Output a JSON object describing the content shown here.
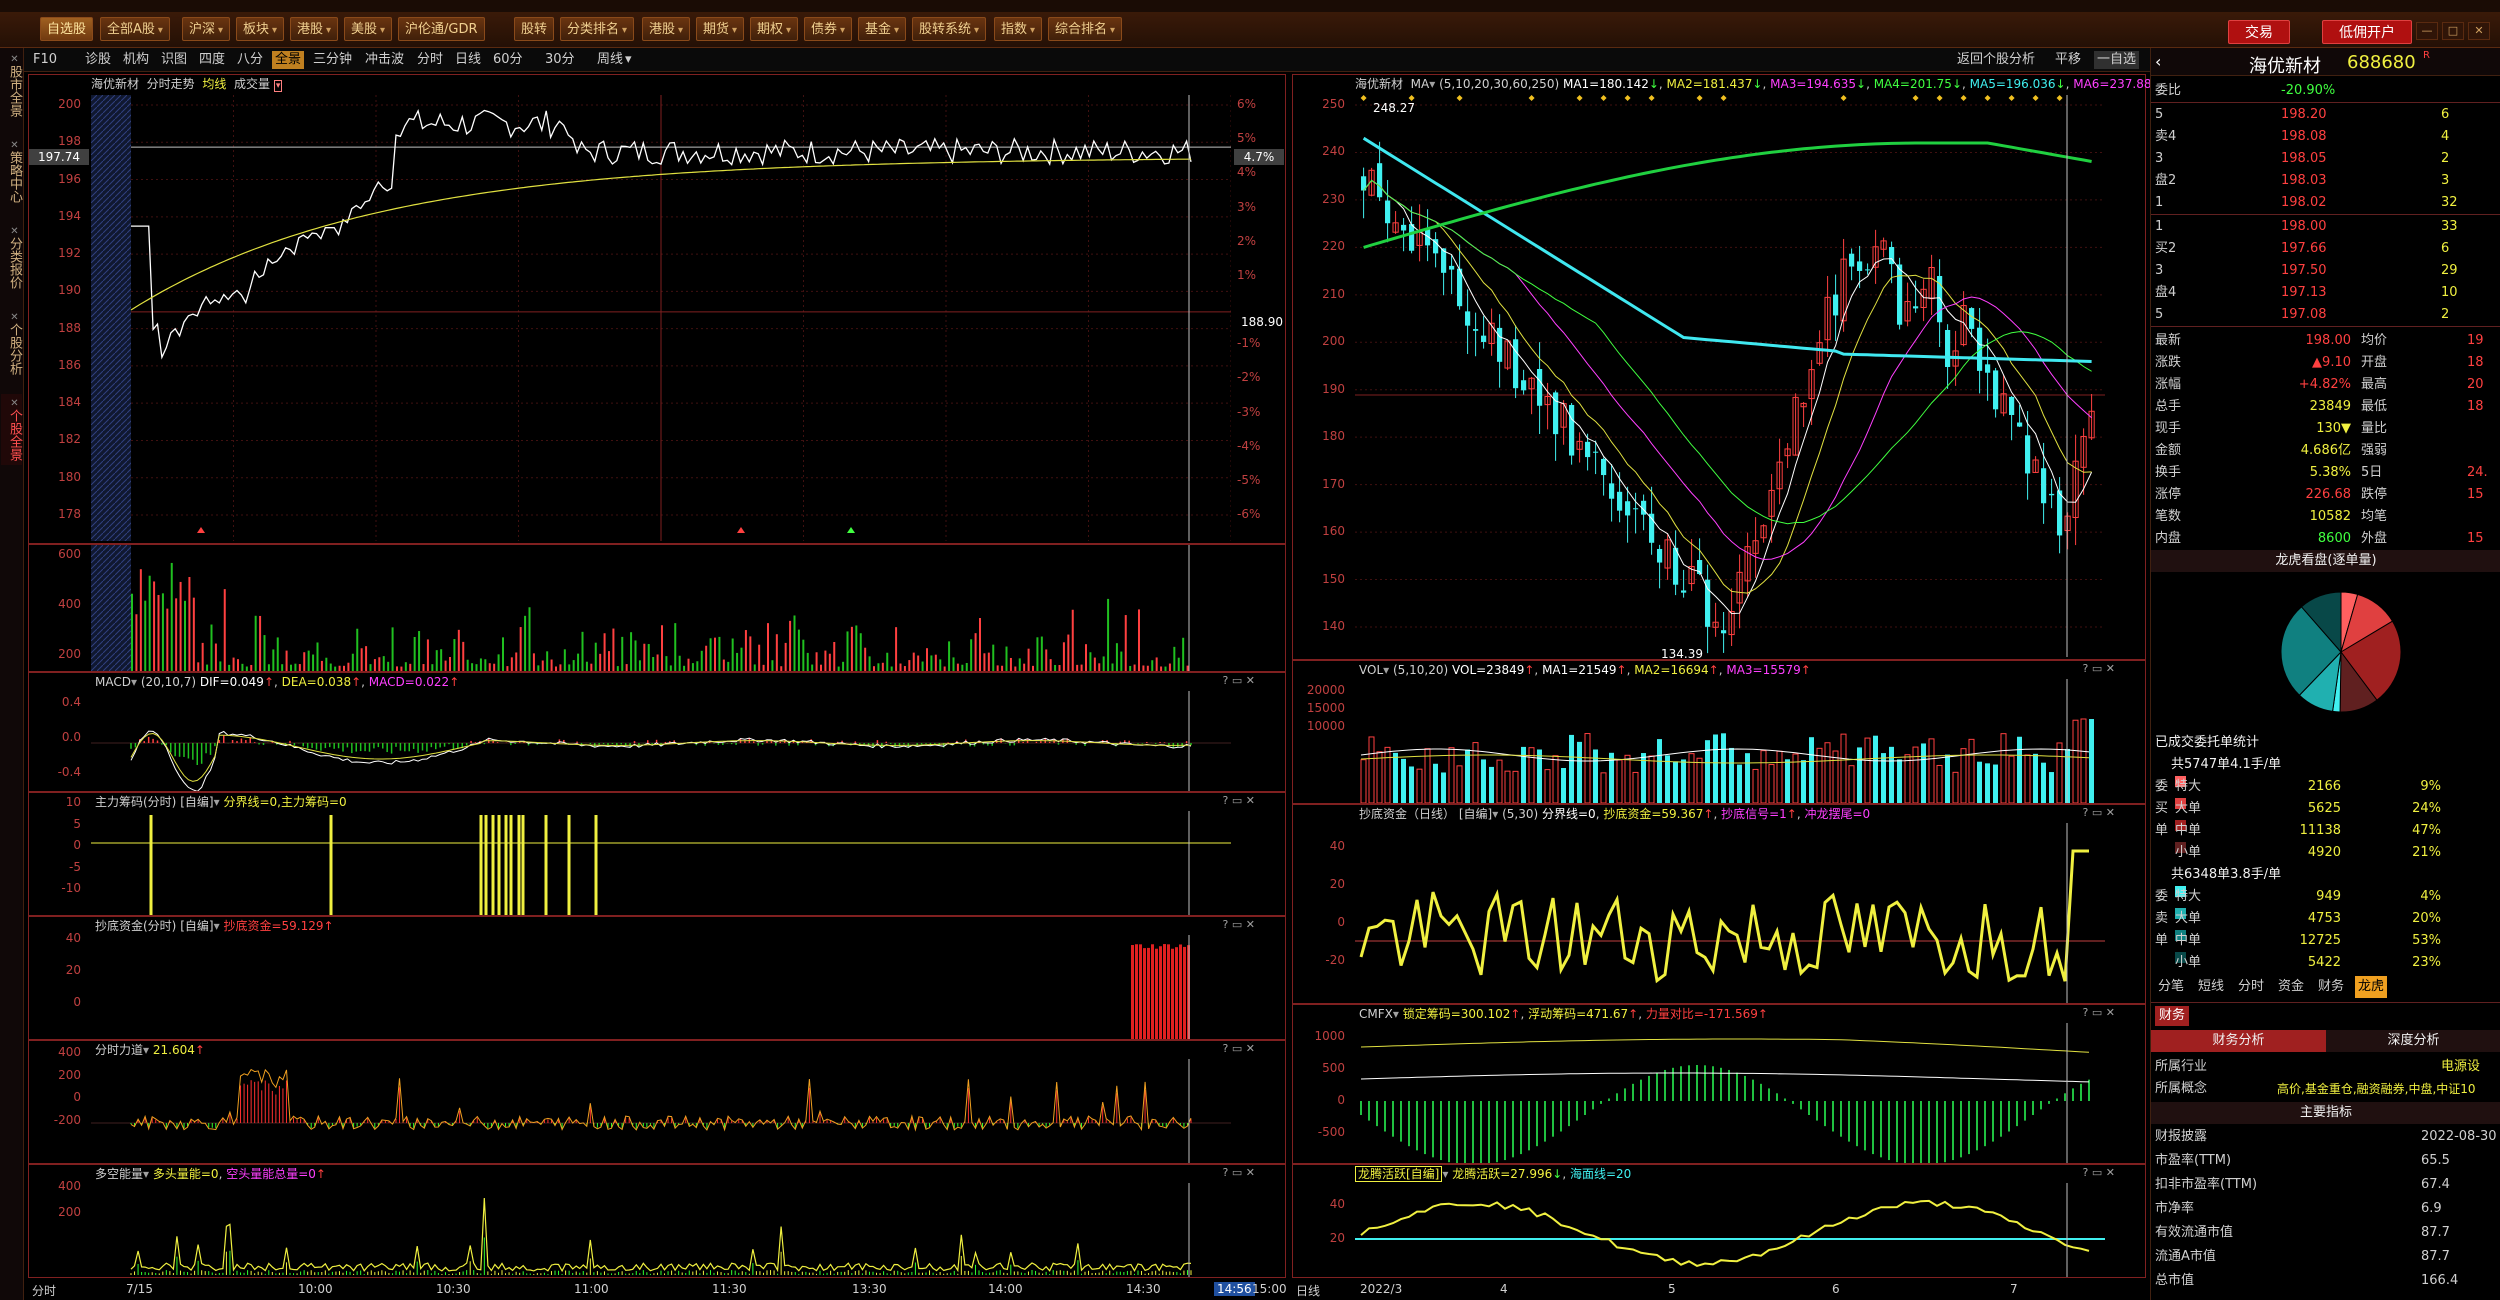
{
  "menubar": {
    "items": [
      {
        "label": "自选股",
        "active": true,
        "arrow": false
      },
      {
        "label": "全部A股",
        "arrow": true
      },
      {
        "label": "沪深",
        "arrow": true
      },
      {
        "label": "板块",
        "arrow": true
      },
      {
        "label": "港股",
        "arrow": true
      },
      {
        "label": "美股",
        "arrow": true
      },
      {
        "label": "沪伦通/GDR",
        "arrow": false
      },
      {
        "label": "股转",
        "arrow": false
      },
      {
        "label": "分类排名",
        "arrow": true
      },
      {
        "label": "港股",
        "arrow": true
      },
      {
        "label": "期货",
        "arrow": true
      },
      {
        "label": "期权",
        "arrow": true
      },
      {
        "label": "债券",
        "arrow": true
      },
      {
        "label": "基金",
        "arrow": true
      },
      {
        "label": "股转系统",
        "arrow": true
      },
      {
        "label": "指数",
        "arrow": true
      },
      {
        "label": "综合排名",
        "arrow": true
      }
    ],
    "trade_btn": "交易",
    "open_btn": "低佣开户"
  },
  "sidebar": {
    "tabs": [
      {
        "label": "股市全景",
        "active": false
      },
      {
        "label": "策略中心",
        "active": false
      },
      {
        "label": "分类报价",
        "active": false
      },
      {
        "label": "个股分析",
        "active": false
      },
      {
        "label": "个股全景",
        "active": true
      }
    ]
  },
  "toolbar": {
    "left_items": [
      "F10",
      "诊股",
      "机构",
      "识图",
      "四度",
      "八分",
      "全景",
      "三分钟",
      "冲击波",
      "分时",
      "日线",
      "60分",
      "30分",
      "周线"
    ],
    "active": "全景",
    "right_items": [
      "返回个股分析",
      "平移",
      "一自选"
    ]
  },
  "intraday": {
    "title": "海优新材",
    "mode": "分时走势",
    "avg_label": "均线",
    "vol_label": "成交量",
    "price_levels": [
      "200",
      "198",
      "196",
      "194",
      "192",
      "190",
      "188",
      "186",
      "184",
      "182",
      "180",
      "178"
    ],
    "pct_levels": [
      "6%",
      "5%",
      "4%",
      "3%",
      "2%",
      "1%",
      "",
      "-1%",
      "-2%",
      "-3%",
      "-4%",
      "-5%",
      "-6%"
    ],
    "current_price": "197.74",
    "current_pct": "4.7%",
    "prev_close": "188.90",
    "vol_levels": [
      "600",
      "400",
      "200"
    ],
    "time_labels": [
      "7/15",
      "10:00",
      "10:30",
      "11:00",
      "11:30",
      "13:30",
      "14:00",
      "14:30",
      "14:56",
      "15:00"
    ],
    "time_label_axis": "分时"
  },
  "macd_intraday": {
    "name": "MACD",
    "params": "(20,10,7)",
    "dif": "DIF=0.049",
    "dea": "DEA=0.038",
    "macd": "MACD=0.022",
    "levels": [
      "0.4",
      "0.0",
      "-0.4"
    ]
  },
  "main_chips": {
    "name": "主力筹码(分时)",
    "tag": "[自编]",
    "value": "分界线=0,主力筹码=0",
    "levels": [
      "10",
      "5",
      "0",
      "-5",
      "-10"
    ]
  },
  "bottom_fund_intraday": {
    "name": "抄底资金(分时)",
    "tag": "[自编]",
    "value": "抄底资金=59.129",
    "levels": [
      "40",
      "20",
      "0"
    ]
  },
  "timeshare_force": {
    "name": "分时力道",
    "value": "21.604",
    "levels": [
      "400",
      "200",
      "0",
      "-200"
    ]
  },
  "long_short": {
    "name": "多空能量",
    "value1": "多头量能=0",
    "value2": "空头量能总量=0",
    "levels": [
      "400",
      "200"
    ]
  },
  "kline": {
    "title": "海优新材",
    "ma_label": "MA",
    "ma_params": "(5,10,20,30,60,250)",
    "ma1": "MA1=180.142",
    "ma2": "MA2=181.437",
    "ma3": "MA3=194.635",
    "ma4": "MA4=201.75",
    "ma5": "MA5=196.036",
    "ma6": "MA6=237.88",
    "price_levels": [
      "250",
      "240",
      "230",
      "220",
      "210",
      "200",
      "190",
      "180",
      "170",
      "160",
      "150",
      "140"
    ],
    "high_mark": "248.27",
    "low_mark": "134.39",
    "date_labels": [
      "日线",
      "2022/3",
      "4",
      "5",
      "6",
      "7"
    ]
  },
  "vol_daily": {
    "name": "VOL",
    "params": "(5,10,20)",
    "vol": "VOL=23849",
    "ma1": "MA1=21549",
    "ma2": "MA2=16694",
    "ma3": "MA3=15579",
    "levels": [
      "20000",
      "15000",
      "10000"
    ]
  },
  "bottom_fund_daily": {
    "name": "抄底资金（日线）",
    "tag": "[自编]",
    "params": "(5,30)",
    "v1": "分界线=0",
    "v2": "抄底资金=59.367",
    "v3": "抄底信号=1",
    "v4": "冲龙摆尾=0",
    "levels": [
      "40",
      "20",
      "0",
      "-20"
    ]
  },
  "cmfx": {
    "name": "CMFX",
    "v1": "锁定筹码=300.102",
    "v2": "浮动筹码=471.67",
    "v3": "力量对比=-171.569",
    "levels": [
      "1000",
      "500",
      "0",
      "-500"
    ]
  },
  "dragon": {
    "name": "龙腾活跃[自编]",
    "v1": "龙腾活跃=27.996",
    "v2": "海面线=20",
    "levels": [
      "40",
      "20"
    ]
  },
  "quote": {
    "name": "海优新材",
    "code": "688680",
    "badge": "R",
    "weibi_label": "委比",
    "weibi": "-20.90%",
    "asks": [
      {
        "label": "5",
        "price": "198.20",
        "vol": "6"
      },
      {
        "label": "卖4",
        "price": "198.08",
        "vol": "4"
      },
      {
        "label": "3",
        "price": "198.05",
        "vol": "2"
      },
      {
        "label": "盘2",
        "price": "198.03",
        "vol": "3"
      },
      {
        "label": "1",
        "price": "198.02",
        "vol": "32"
      }
    ],
    "bids": [
      {
        "label": "1",
        "price": "198.00",
        "vol": "33"
      },
      {
        "label": "买2",
        "price": "197.66",
        "vol": "6"
      },
      {
        "label": "3",
        "price": "197.50",
        "vol": "29"
      },
      {
        "label": "盘4",
        "price": "197.13",
        "vol": "10"
      },
      {
        "label": "5",
        "price": "197.08",
        "vol": "2"
      }
    ],
    "stats": [
      {
        "l1": "最新",
        "v1": "198.00",
        "l2": "均价",
        "v2": "19"
      },
      {
        "l1": "涨跌",
        "v1": "▲9.10",
        "l2": "开盘",
        "v2": "18"
      },
      {
        "l1": "涨幅",
        "v1": "+4.82%",
        "l2": "最高",
        "v2": "20"
      },
      {
        "l1": "总手",
        "v1": "23849",
        "l2": "最低",
        "v2": "18"
      },
      {
        "l1": "现手",
        "v1": "130▼",
        "l2": "量比",
        "v2": ""
      },
      {
        "l1": "金额",
        "v1": "4.686亿",
        "l2": "强弱",
        "v2": ""
      },
      {
        "l1": "换手",
        "v1": "5.38%",
        "l2": "5日",
        "v2": "24."
      },
      {
        "l1": "涨停",
        "v1": "226.68",
        "l2": "跌停",
        "v2": "15"
      },
      {
        "l1": "笔数",
        "v1": "10582",
        "l2": "均笔",
        "v2": ""
      },
      {
        "l1": "内盘",
        "v1": "8600",
        "l2": "外盘",
        "v2": "15"
      }
    ],
    "pie_title": "龙虎看盘(逐单量)",
    "order_title": "已成交委托单统计",
    "buy_total": "共5747单4.1手/单",
    "buy_rows": [
      {
        "side": "委",
        "label": "特大",
        "count": "2166",
        "pct": "9%",
        "color": "#ff6060"
      },
      {
        "side": "买",
        "label": "大单",
        "count": "5625",
        "pct": "24%",
        "color": "#e04040"
      },
      {
        "side": "单",
        "label": "中单",
        "count": "11138",
        "pct": "47%",
        "color": "#a02020"
      },
      {
        "side": "",
        "label": "小单",
        "count": "4920",
        "pct": "21%",
        "color": "#602020"
      }
    ],
    "sell_total": "共6348单3.8手/单",
    "sell_rows": [
      {
        "side": "委",
        "label": "特大",
        "count": "949",
        "pct": "4%",
        "color": "#40f0f0"
      },
      {
        "side": "卖",
        "label": "大单",
        "count": "4753",
        "pct": "20%",
        "color": "#20b0b0"
      },
      {
        "side": "单",
        "label": "中单",
        "count": "12725",
        "pct": "53%",
        "color": "#108080"
      },
      {
        "side": "",
        "label": "小单",
        "count": "5422",
        "pct": "23%",
        "color": "#084848"
      }
    ],
    "tabs": [
      "分笔",
      "短线",
      "分时",
      "资金",
      "财务",
      "龙虎"
    ],
    "active_tab": "龙虎",
    "finance_tab": "财务",
    "fin_tabs": [
      "财务分析",
      "深度分析"
    ],
    "industry_label": "所属行业",
    "industry": "电源设",
    "concept_label": "所属概念",
    "concept": "高价,基金重仓,融资融券,中盘,中证10",
    "indicators_title": "主要指标",
    "indicators": [
      {
        "label": "财报披露",
        "value": "2022-08-30"
      },
      {
        "label": "市盈率(TTM)",
        "value": "65.5"
      },
      {
        "label": "扣非市盈率(TTM)",
        "value": "67.4"
      },
      {
        "label": "市净率",
        "value": "6.9"
      },
      {
        "label": "有效流通市值",
        "value": "87.7"
      },
      {
        "label": "流通A市值",
        "value": "87.7"
      },
      {
        "label": "总市值",
        "value": "166.4"
      }
    ]
  }
}
